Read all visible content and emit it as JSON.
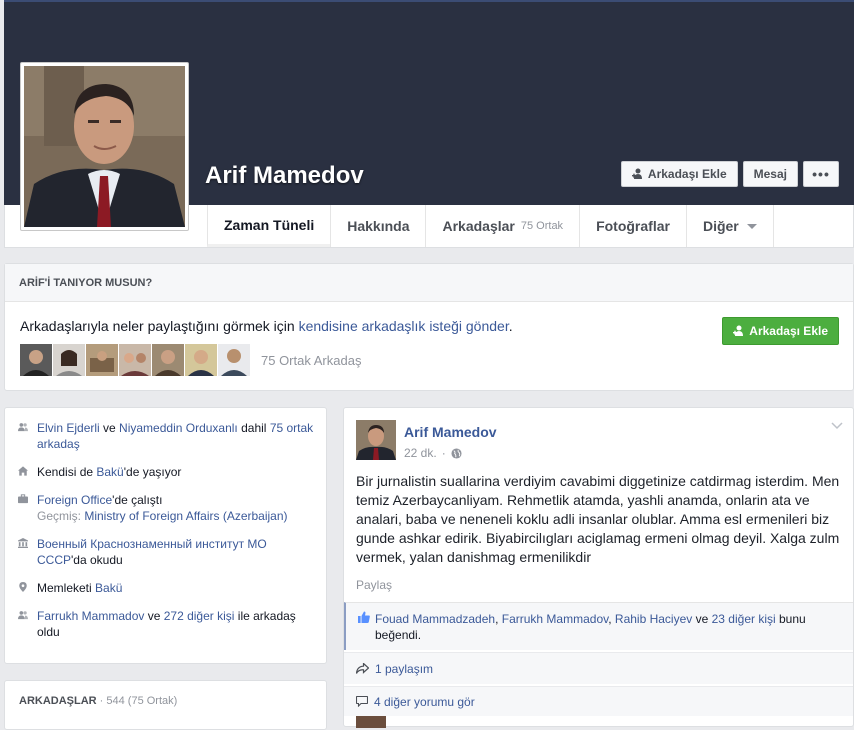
{
  "profile": {
    "name": "Arif Mamedov"
  },
  "cover_actions": {
    "add_friend": "Arkadaşı Ekle",
    "message": "Mesaj",
    "more": "•••"
  },
  "tabs": [
    {
      "label": "Zaman Tüneli",
      "sub": ""
    },
    {
      "label": "Hakkında",
      "sub": ""
    },
    {
      "label": "Arkadaşlar",
      "sub": "75 Ortak"
    },
    {
      "label": "Fotoğraflar",
      "sub": ""
    },
    {
      "label": "Diğer",
      "sub": ""
    }
  ],
  "know": {
    "heading": "ARİF'İ TANIYOR MUSUN?",
    "text_before": "Arkadaşlarıyla neler paylaştığını görmek için ",
    "text_link": "kendisine arkadaşlık isteği gönder",
    "text_after": ".",
    "add_button": "Arkadaşı Ekle",
    "mutual": "75 Ortak Arkadaş"
  },
  "intro": {
    "friends": {
      "a": "Elvin Ejderli",
      "mid": " ve ",
      "b": "Niyameddin Orduxanlı",
      "dahil": " dahil ",
      "count": "75 ortak arkadaş"
    },
    "lives": {
      "prefix": "Kendisi de ",
      "place": "Bakü",
      "suffix": "'de yaşıyor"
    },
    "works": {
      "employer": "Foreign Office",
      "suffix": "'de çalıştı",
      "past_label": "Geçmiş: ",
      "past": "Ministry of Foreign Affairs (Azerbaijan)"
    },
    "studied": {
      "school": "Военный Краснознаменный институт МО СССР",
      "suffix": "'da okudu"
    },
    "from": {
      "prefix": "Memleketi ",
      "place": "Bakü"
    },
    "friends_with": {
      "a": "Farrukh Mammadov",
      "mid": " ve ",
      "b": "272 diğer kişi",
      "suffix": " ile arkadaş oldu"
    }
  },
  "friends_box": {
    "title": "ARKADAŞLAR",
    "count": " · 544 (75 Ortak)"
  },
  "post": {
    "author": "Arif Mamedov",
    "time": "22 dk.",
    "text": "Bir jurnalistin suallarina verdiyim cavabimi diggetinize catdirmag isterdim. Men temiz Azerbaycanliyam. Rehmetlik atamda, yashli anamda, onlarin ata ve analari, baba ve neneneli koklu adli insanlar olublar. Amma esl ermenileri biz gunde ashkar edirik. Biyabircilıgları aciglamag ermeni olmag deyil. Xalga zulm vermek, yalan danishmag ermenilikdir",
    "share": "Paylaş",
    "likes": {
      "p1": "Fouad Mammadzadeh",
      "p2": "Farrukh Mammadov",
      "p3": "Rahib Haciyev",
      "sep": ", ",
      "ve": " ve ",
      "others": "23 diğer kişi",
      "suffix": " bunu beğendi."
    },
    "shares": "1 paylaşım",
    "comments": "4 diğer yorumu gör"
  }
}
